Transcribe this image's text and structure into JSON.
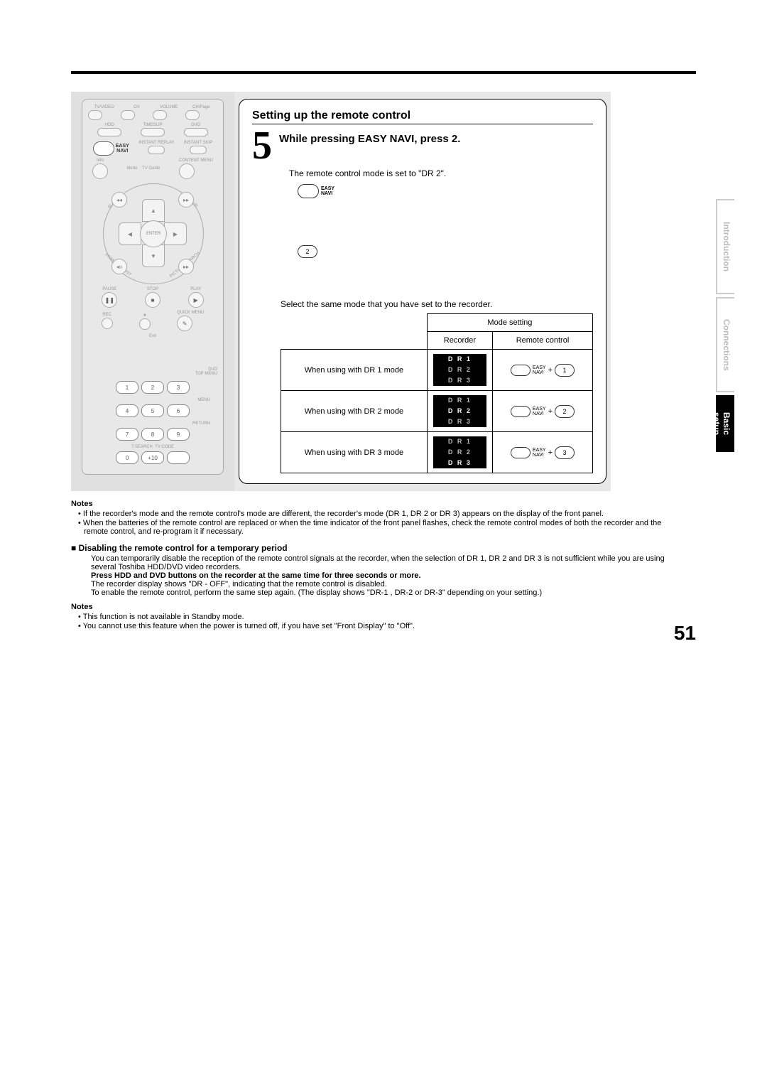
{
  "page_number": "51",
  "tabs": {
    "intro": "Introduction",
    "conn": "Connections",
    "basic": "Basic setup"
  },
  "panel": {
    "title": "Setting up the remote control",
    "step_num": "5",
    "step_head": "While pressing EASY NAVI, press 2.",
    "step_body": "The remote control mode is set to \"DR 2\".",
    "easy_navi_label": "EASY\nNAVI",
    "key2": "2",
    "select_line": "Select the same mode that you have set to the recorder.",
    "table": {
      "mode_setting": "Mode setting",
      "recorder": "Recorder",
      "remote": "Remote control",
      "rows": [
        {
          "when": "When using with DR 1 mode",
          "dr": [
            "D R 1",
            "D R 2",
            "D R 3"
          ],
          "hi": 0,
          "num": "1"
        },
        {
          "when": "When using with DR 2 mode",
          "dr": [
            "D R 1",
            "D R 2",
            "D R 3"
          ],
          "hi": 1,
          "num": "2"
        },
        {
          "when": "When using with DR 3 mode",
          "dr": [
            "D R 1",
            "D R 2",
            "D R 3"
          ],
          "hi": 2,
          "num": "3"
        }
      ],
      "nav_small": "EASY\nNAVI",
      "plus": "+"
    }
  },
  "remote_labels": {
    "row1": [
      "TV/VIDEO",
      "CH",
      "VOLUME",
      "CH/Page"
    ],
    "row2": [
      "HDD",
      "TIMESLIP",
      "DVD"
    ],
    "row3": [
      "INSTANT REPLAY",
      "INSTANT SKIP"
    ],
    "easy": "EASY\nNAVI",
    "menu": "Menu",
    "tvguide": "TV Guide",
    "info": "Info",
    "content": "CONTENT MENU",
    "slow": "SLOW",
    "skip": "SKIP",
    "enter": "ENTER",
    "frame": "FRAME/ADJUST",
    "picture": "PICTURE SEARCH",
    "pause": "PAUSE",
    "stop": "STOP",
    "play": "PLAY",
    "rec": "REC",
    "quick": "QUICK MENU",
    "exit": "Exit",
    "dvd_top": "DVD\nTOP MENU",
    "menu2": "MENU",
    "return": "RETURN",
    "tsearch": "T.SEARCH",
    "tvcode": "TV CODE",
    "nums": [
      "1",
      "2",
      "3",
      "4",
      "5",
      "6",
      "7",
      "8",
      "9",
      "0",
      "+10"
    ]
  },
  "notes1_title": "Notes",
  "notes1": [
    "If the recorder's mode and the remote control's mode are different, the recorder's mode (DR 1, DR 2 or DR 3) appears on the display of the front panel.",
    "When the batteries of the remote control are replaced or when the time indicator of the front panel flashes, check the remote control modes of both the recorder and the remote control, and re-program it if necessary."
  ],
  "disable_title": "Disabling the remote control for a temporary period",
  "disable_body": [
    "You can temporarily disable the reception of the remote control signals at the recorder, when the selection of DR 1, DR 2 and DR 3 is not sufficient while you are using several Toshiba HDD/DVD video recorders.",
    "Press HDD and DVD buttons on the recorder at the same time for three seconds or more.",
    "The recorder display shows \"DR - OFF\", indicating that the remote control is disabled.",
    "To enable the remote control, perform the same step again. (The display shows \"DR-1 , DR-2 or DR-3\" depending on your setting.)"
  ],
  "notes2_title": "Notes",
  "notes2": [
    "This function is not available in Standby mode.",
    "You cannot use this feature when the power is turned off, if you have set \"Front Display\" to \"Off\"."
  ]
}
